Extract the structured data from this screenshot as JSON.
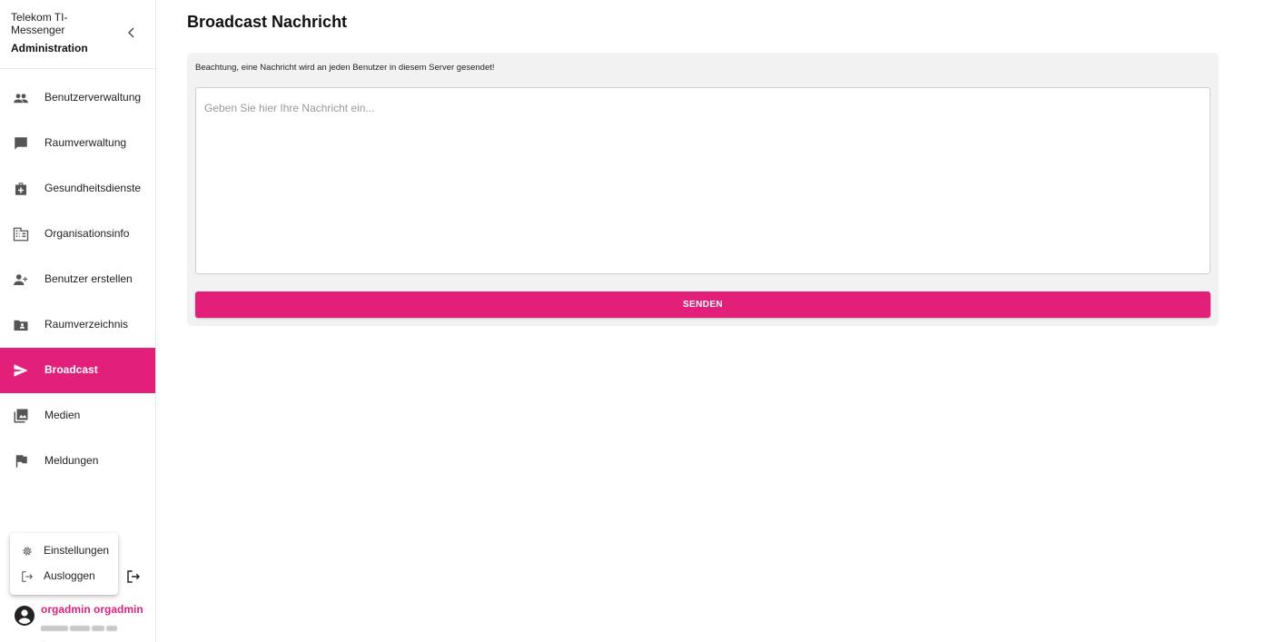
{
  "brand": {
    "title": "Telekom TI-Messenger",
    "subtitle": "Administration"
  },
  "nav": {
    "items": [
      {
        "label": "Benutzerverwaltung",
        "icon": "people-icon"
      },
      {
        "label": "Raumverwaltung",
        "icon": "chat-bubble-icon"
      },
      {
        "label": "Gesundheitsdienste",
        "icon": "medical-bag-icon"
      },
      {
        "label": "Organisationsinfo",
        "icon": "building-icon"
      },
      {
        "label": "Benutzer erstellen",
        "icon": "person-add-icon"
      },
      {
        "label": "Raumverzeichnis",
        "icon": "folder-shared-icon"
      },
      {
        "label": "Broadcast",
        "icon": "send-icon",
        "active": true
      },
      {
        "label": "Medien",
        "icon": "photo-library-icon"
      },
      {
        "label": "Meldungen",
        "icon": "flag-icon"
      }
    ]
  },
  "menu": {
    "settings_label": "Einstellungen",
    "logout_label": "Ausloggen"
  },
  "user": {
    "name": "orgadmin orgadmin"
  },
  "main": {
    "title": "Broadcast Nachricht",
    "notice": "Beachtung, eine Nachricht wird an jeden Benutzer in diesem Server gesendet!",
    "message_placeholder": "Geben Sie hier Ihre Nachricht ein...",
    "message_value": "",
    "send_label": "SENDEN"
  },
  "colors": {
    "accent": "#e2207a",
    "card_bg": "#f2f2f2",
    "border": "#cfcfcf"
  }
}
